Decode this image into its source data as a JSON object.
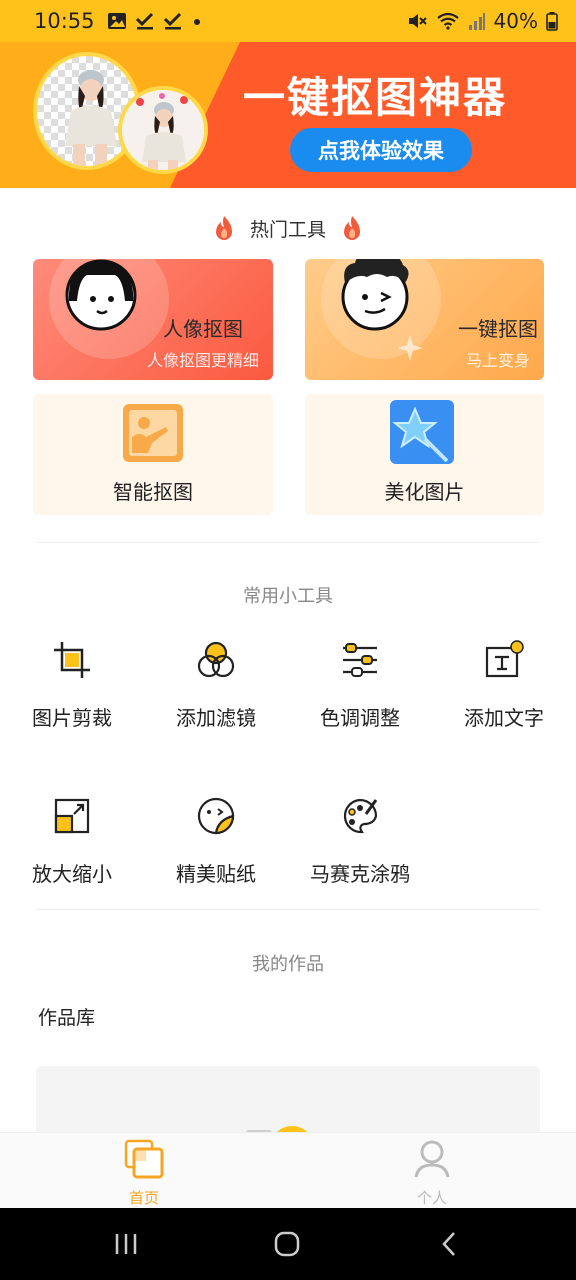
{
  "status_bar": {
    "time": "10:55",
    "battery": "40%"
  },
  "banner": {
    "title": "一键抠图神器",
    "button": "点我体验效果"
  },
  "hot_tools": {
    "title": "热门工具",
    "cards": [
      {
        "title": "人像抠图",
        "subtitle": "人像抠图更精细"
      },
      {
        "title": "一键抠图",
        "subtitle": "马上变身"
      },
      {
        "title": "智能抠图"
      },
      {
        "title": "美化图片"
      }
    ]
  },
  "common_tools": {
    "title": "常用小工具",
    "items": [
      {
        "label": "图片剪裁",
        "icon": "crop-icon"
      },
      {
        "label": "添加滤镜",
        "icon": "filter-icon"
      },
      {
        "label": "色调调整",
        "icon": "sliders-icon"
      },
      {
        "label": "添加文字",
        "icon": "text-icon"
      },
      {
        "label": "放大缩小",
        "icon": "resize-icon"
      },
      {
        "label": "精美贴纸",
        "icon": "sticker-icon"
      },
      {
        "label": "马赛克涂鸦",
        "icon": "palette-icon"
      }
    ]
  },
  "my_works": {
    "title": "我的作品",
    "library": "作品库"
  },
  "bottom_nav": {
    "home": "首页",
    "me": "个人"
  },
  "colors": {
    "accent": "#ffc21a",
    "banner_red": "#ff5a2a",
    "button_blue": "#1a8cf0",
    "nav_active": "#f6a623"
  }
}
